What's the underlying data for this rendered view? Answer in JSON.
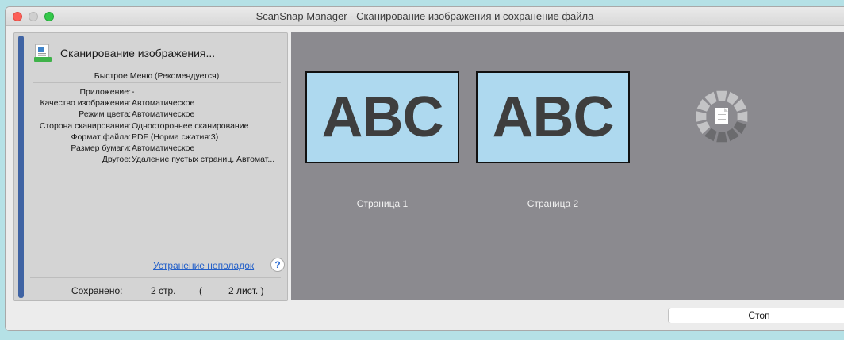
{
  "window": {
    "title": "ScanSnap Manager - Сканирование изображения и сохранение файла"
  },
  "status": {
    "title": "Сканирование изображения...",
    "icon": "scan-document-icon"
  },
  "mode_label": "Быстрое Меню (Рекомендуется)",
  "settings": [
    {
      "key": "Приложение:",
      "value": "-"
    },
    {
      "key": "Качество изображения:",
      "value": "Автоматическое"
    },
    {
      "key": "Режим цвета:",
      "value": "Автоматическое"
    },
    {
      "key": "Сторона сканирования:",
      "value": "Одностороннее сканирование"
    },
    {
      "key": "Формат файла:",
      "value": "PDF (Норма сжатия:3)"
    },
    {
      "key": "Размер бумаги:",
      "value": "Автоматическое"
    },
    {
      "key": "Другое:",
      "value": "Удаление пустых страниц, Автомат..."
    }
  ],
  "help": {
    "link_label": "Устранение неполадок",
    "button_label": "?"
  },
  "saved": {
    "label": "Сохранено:",
    "pages": "2 стр.",
    "open_paren": "(",
    "sheets": "2 лист. )"
  },
  "pages": [
    {
      "preview_text": "ABC",
      "label": "Страница 1"
    },
    {
      "preview_text": "ABC",
      "label": "Страница 2"
    }
  ],
  "stop_button": "Стоп",
  "colors": {
    "background": "#b5e1e6",
    "preview_area": "#8b8a8f",
    "page_fill": "#aed9ef",
    "progress_rail": "#3f63a3",
    "link": "#2460c9"
  }
}
